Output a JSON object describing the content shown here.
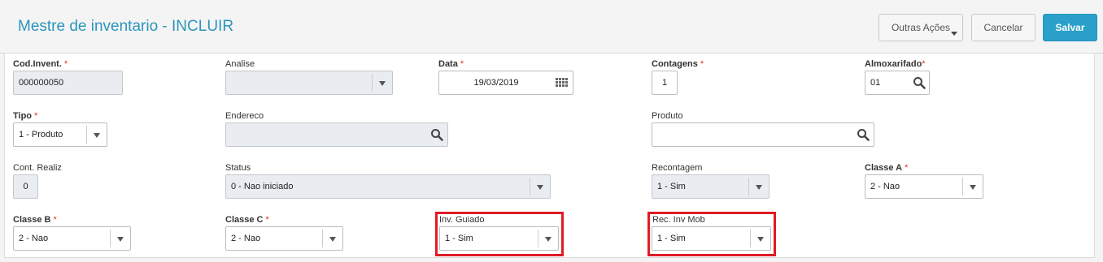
{
  "header": {
    "title": "Mestre de inventario - INCLUIR"
  },
  "actions": {
    "outras": "Outras Ações",
    "cancelar": "Cancelar",
    "salvar": "Salvar"
  },
  "form": {
    "cod_invent": {
      "label": "Cod.Invent.",
      "value": "000000050",
      "required": true
    },
    "analise": {
      "label": "Analise",
      "value": ""
    },
    "data": {
      "label": "Data",
      "value": "19/03/2019",
      "required": true
    },
    "contagens": {
      "label": "Contagens",
      "value": "1",
      "required": true
    },
    "almoxarifado": {
      "label": "Almoxarifado",
      "value": "01",
      "required": true
    },
    "tipo": {
      "label": "Tipo",
      "value": "1 - Produto",
      "required": true
    },
    "endereco": {
      "label": "Endereco",
      "value": ""
    },
    "produto": {
      "label": "Produto",
      "value": ""
    },
    "cont_realiz": {
      "label": "Cont. Realiz",
      "value": "0"
    },
    "status": {
      "label": "Status",
      "value": "0 - Nao iniciado"
    },
    "recontagem": {
      "label": "Recontagem",
      "value": "1 - Sim"
    },
    "classe_a": {
      "label": "Classe A",
      "value": "2 - Nao",
      "required": true
    },
    "classe_b": {
      "label": "Classe B",
      "value": "2 - Nao",
      "required": true
    },
    "classe_c": {
      "label": "Classe C",
      "value": "2 - Nao",
      "required": true
    },
    "inv_guiado": {
      "label": "Inv. Guiado",
      "value": "1 - Sim"
    },
    "rec_inv_mob": {
      "label": "Rec. Inv Mob",
      "value": "1 - Sim"
    }
  },
  "required_mark": "*",
  "colors": {
    "accent": "#2b95bd",
    "save_button": "#2aa0ca",
    "required": "#e0312b",
    "highlight": "#e01b24",
    "disabled_field": "#e9ecf1"
  },
  "icons": {
    "search": "magnifier-icon",
    "calendar": "calendar-icon",
    "dropdown": "chevron-down-icon"
  }
}
